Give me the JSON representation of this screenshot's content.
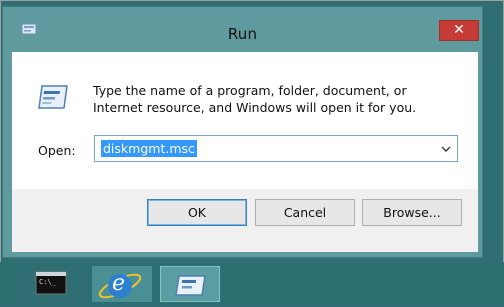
{
  "window": {
    "title": "Run",
    "close_label": "✕",
    "description": "Type the name of a program, folder, document, or Internet resource, and Windows will open it for you.",
    "open_label": "Open:",
    "open_value": "diskmgmt.msc",
    "buttons": {
      "ok": "OK",
      "cancel": "Cancel",
      "browse": "Browse..."
    }
  },
  "taskbar": {
    "items": [
      {
        "name": "command-prompt",
        "icon": "cmd-icon",
        "label": "C:\\_"
      },
      {
        "name": "internet-explorer",
        "icon": "ie-icon",
        "label": "e"
      },
      {
        "name": "run",
        "icon": "run-icon",
        "label": ""
      }
    ]
  },
  "colors": {
    "desktop": "#2f6e72",
    "window_frame": "#5f9a9f",
    "close_button": "#c43c35",
    "selection": "#3399ff"
  }
}
